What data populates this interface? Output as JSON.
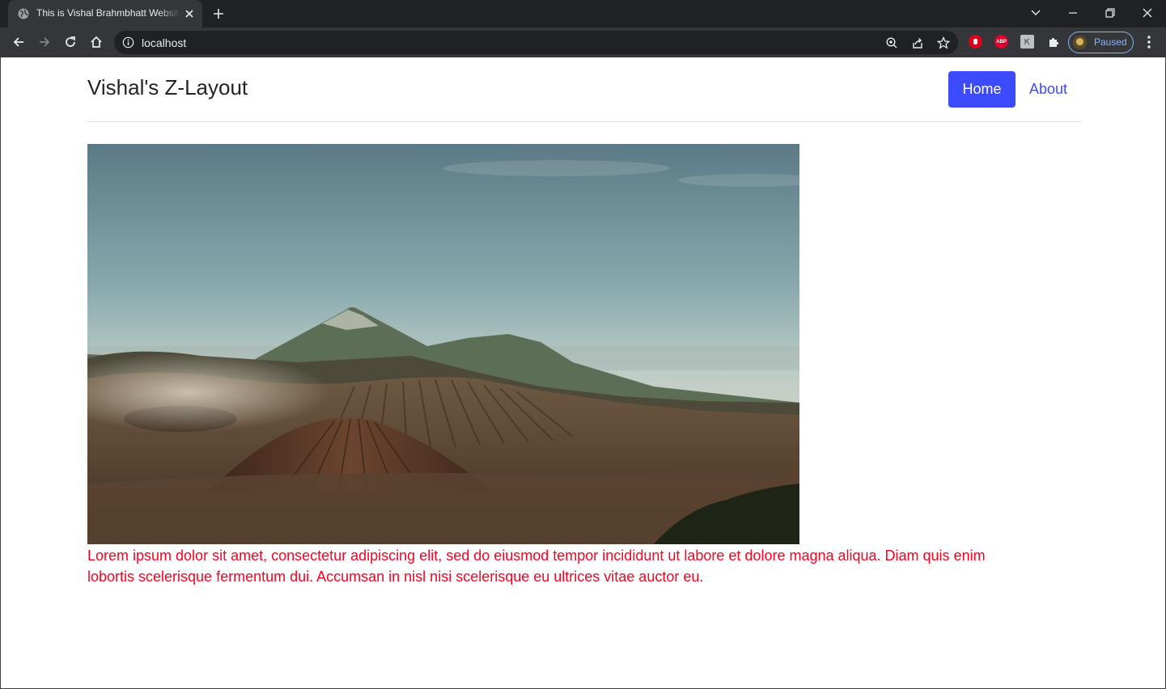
{
  "browser": {
    "tab_title": "This is Vishal Brahmbhatt Website",
    "url": "localhost",
    "profile_label": "Paused"
  },
  "site": {
    "title": "Vishal's Z-Layout",
    "nav": {
      "home": "Home",
      "about": "About"
    },
    "paragraph": "Lorem ipsum dolor sit amet, consectetur adipiscing elit, sed do eiusmod tempor incididunt ut labore et dolore magna aliqua. Diam quis enim lobortis scelerisque fermentum dui. Accumsan in nisl nisi scelerisque eu ultrices vitae auctor eu."
  },
  "colors": {
    "accent": "#3d4bff",
    "paragraph_text": "#ff0022",
    "chrome_dark": "#202124",
    "chrome_toolbar": "#35363a"
  },
  "icons": {
    "favicon": "globe-icon",
    "hero_image": "volcano-landscape-photo"
  }
}
